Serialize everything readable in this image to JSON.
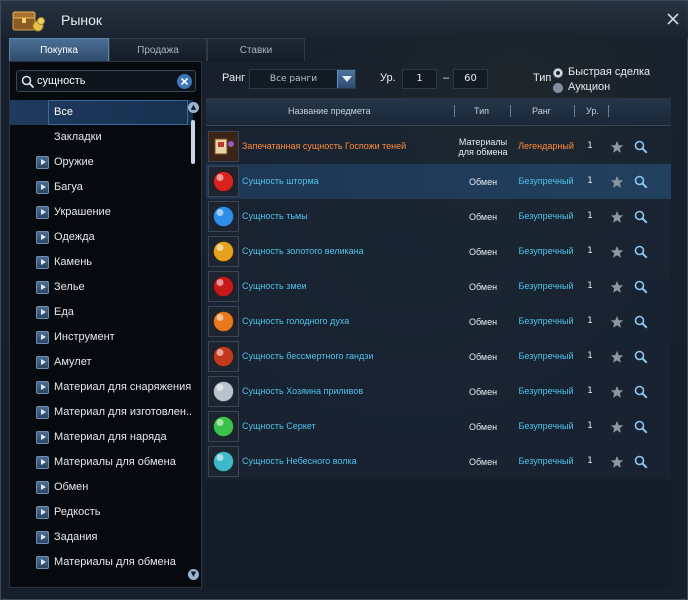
{
  "window": {
    "title": "Рынок"
  },
  "tabs": [
    {
      "label": "Покупка",
      "active": true
    },
    {
      "label": "Продажа",
      "active": false
    },
    {
      "label": "Ставки",
      "active": false
    }
  ],
  "search": {
    "value": "сущность",
    "placeholder": ""
  },
  "categories": [
    {
      "label": "Все",
      "selected": true,
      "expandable": false
    },
    {
      "label": "Закладки",
      "selected": false,
      "expandable": false
    },
    {
      "label": "Оружие",
      "selected": false,
      "expandable": true
    },
    {
      "label": "Багуа",
      "selected": false,
      "expandable": true
    },
    {
      "label": "Украшение",
      "selected": false,
      "expandable": true
    },
    {
      "label": "Одежда",
      "selected": false,
      "expandable": true
    },
    {
      "label": "Камень",
      "selected": false,
      "expandable": true
    },
    {
      "label": "Зелье",
      "selected": false,
      "expandable": true
    },
    {
      "label": "Еда",
      "selected": false,
      "expandable": true
    },
    {
      "label": "Инструмент",
      "selected": false,
      "expandable": true
    },
    {
      "label": "Амулет",
      "selected": false,
      "expandable": true
    },
    {
      "label": "Материал для снаряжения",
      "selected": false,
      "expandable": true
    },
    {
      "label": "Материал для изготовлен...",
      "selected": false,
      "expandable": true
    },
    {
      "label": "Материал для наряда",
      "selected": false,
      "expandable": true
    },
    {
      "label": "Материалы для обмена",
      "selected": false,
      "expandable": true
    },
    {
      "label": "Обмен",
      "selected": false,
      "expandable": true
    },
    {
      "label": "Редкость",
      "selected": false,
      "expandable": true
    },
    {
      "label": "Задания",
      "selected": false,
      "expandable": true
    },
    {
      "label": "Материалы для обмена",
      "selected": false,
      "expandable": true
    }
  ],
  "filters": {
    "rank_label": "Ранг",
    "rank_value": "Все ранги",
    "level_label": "Ур.",
    "level_min": "1",
    "level_dash": "–",
    "level_max": "60",
    "type_label": "Тип",
    "type_options": [
      {
        "label": "Быстрая сделка",
        "checked": true
      },
      {
        "label": "Аукцион",
        "checked": false
      }
    ]
  },
  "table": {
    "headers": {
      "name": "Название предмета",
      "type": "Тип",
      "rank": "Ранг",
      "level": "Ур."
    },
    "rows": [
      {
        "name": "Запечатанная сущность Госпожи теней",
        "name_color": "#ff8a3a",
        "type": "Материалы для обмена",
        "rank": "Легендарный",
        "rank_color": "#ff8a3a",
        "level": "1",
        "icon": "sealed-box-icon",
        "icon_color": "#8a5a3a",
        "selected": false
      },
      {
        "name": "Сущность шторма",
        "name_color": "#4fc3ea",
        "type": "Обмен",
        "rank": "Безупречный",
        "rank_color": "#4fc3ea",
        "level": "1",
        "icon": "red-orb-icon",
        "icon_color": "#d8221e",
        "selected": true
      },
      {
        "name": "Сущность тьмы",
        "name_color": "#4fc3ea",
        "type": "Обмен",
        "rank": "Безупречный",
        "rank_color": "#4fc3ea",
        "level": "1",
        "icon": "blue-orb-icon",
        "icon_color": "#2e8fe8",
        "selected": false
      },
      {
        "name": "Сущность золотого великана",
        "name_color": "#4fc3ea",
        "type": "Обмен",
        "rank": "Безупречный",
        "rank_color": "#4fc3ea",
        "level": "1",
        "icon": "golden-essence-icon",
        "icon_color": "#e6a21c",
        "selected": false
      },
      {
        "name": "Сущность змеи",
        "name_color": "#4fc3ea",
        "type": "Обмен",
        "rank": "Безупречный",
        "rank_color": "#4fc3ea",
        "level": "1",
        "icon": "red-orb-icon",
        "icon_color": "#c61a1a",
        "selected": false
      },
      {
        "name": "Сущность голодного духа",
        "name_color": "#4fc3ea",
        "type": "Обмен",
        "rank": "Безупречный",
        "rank_color": "#4fc3ea",
        "level": "1",
        "icon": "fire-essence-icon",
        "icon_color": "#e8781c",
        "selected": false
      },
      {
        "name": "Сущность бессмертного гандзи",
        "name_color": "#4fc3ea",
        "type": "Обмен",
        "rank": "Безупречный",
        "rank_color": "#4fc3ea",
        "level": "1",
        "icon": "crimson-essence-icon",
        "icon_color": "#c23a1e",
        "selected": false
      },
      {
        "name": "Сущность Хозяина приливов",
        "name_color": "#4fc3ea",
        "type": "Обмен",
        "rank": "Безупречный",
        "rank_color": "#4fc3ea",
        "level": "1",
        "icon": "silver-essence-icon",
        "icon_color": "#b9c2cc",
        "selected": false
      },
      {
        "name": "Сущность Серкет",
        "name_color": "#4fc3ea",
        "type": "Обмен",
        "rank": "Безупречный",
        "rank_color": "#4fc3ea",
        "level": "1",
        "icon": "green-essence-icon",
        "icon_color": "#3cc24a",
        "selected": false
      },
      {
        "name": "Сущность Небесного волка",
        "name_color": "#4fc3ea",
        "type": "Обмен",
        "rank": "Безупречный",
        "rank_color": "#4fc3ea",
        "level": "1",
        "icon": "teal-essence-icon",
        "icon_color": "#3fb8c8",
        "selected": false
      }
    ]
  }
}
